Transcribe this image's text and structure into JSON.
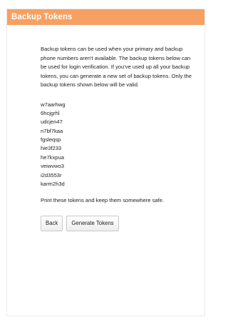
{
  "panel": {
    "title": "Backup Tokens",
    "header_color": "#f6a063"
  },
  "intro_text": "Backup tokens can be used when your primary and backup phone numbers aren't available. The backup tokens below can be used for login verification. If you've used up all your backup tokens, you can generate a new set of backup tokens. Only the backup tokens shown below will be valid.",
  "tokens": [
    "w7aarhwg",
    "6hcjgrhl",
    "udcjen47",
    "n7bf7kaa",
    "fgsleqsp",
    "hie3f233",
    "he7kxpua",
    "veiwvwo3",
    "i2d3553r",
    "karm2h3d"
  ],
  "outro_text": "Print these tokens and keep them somewhere safe.",
  "buttons": {
    "back": "Back",
    "generate": "Generate Tokens"
  }
}
